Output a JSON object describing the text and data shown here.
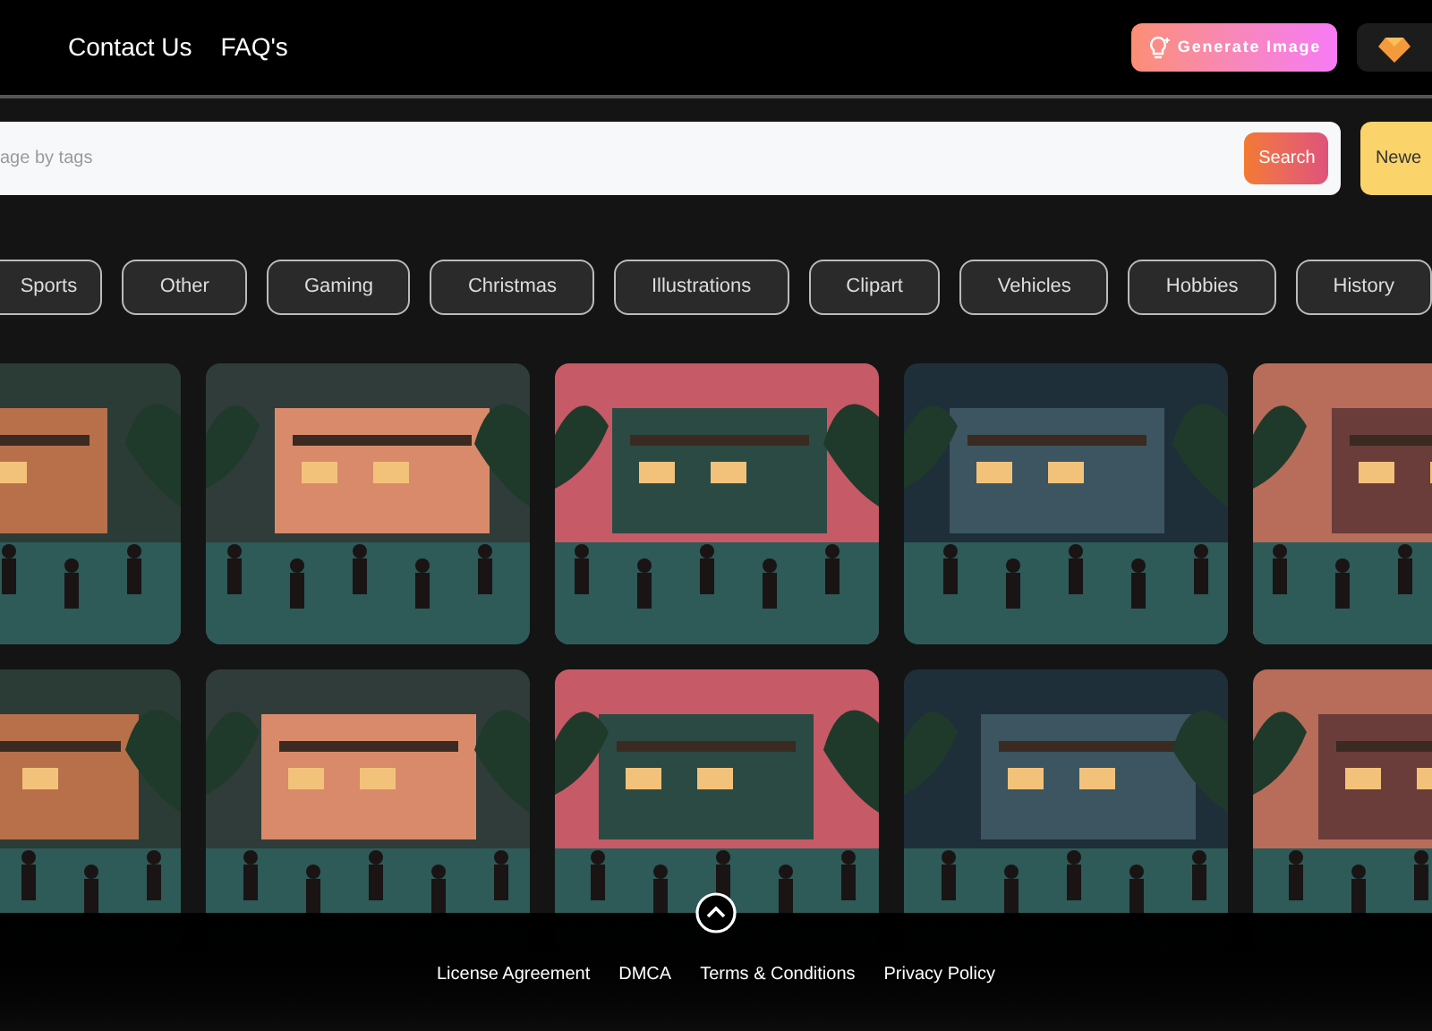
{
  "header": {
    "nav": [
      "Contact Us",
      "FAQ's"
    ],
    "generate_button": "Generate Image"
  },
  "search": {
    "placeholder": "age by tags",
    "button": "Search",
    "sort_button": "Newe"
  },
  "tags": [
    {
      "label": "Sports"
    },
    {
      "label": "Other"
    },
    {
      "label": "Gaming"
    },
    {
      "label": "Christmas"
    },
    {
      "label": "Illustrations"
    },
    {
      "label": "Clipart"
    },
    {
      "label": "Vehicles"
    },
    {
      "label": "Hobbies"
    },
    {
      "label": "History"
    }
  ],
  "footer": {
    "links": [
      "License Agreement",
      "DMCA",
      "Terms & Conditions",
      "Privacy Policy"
    ]
  }
}
